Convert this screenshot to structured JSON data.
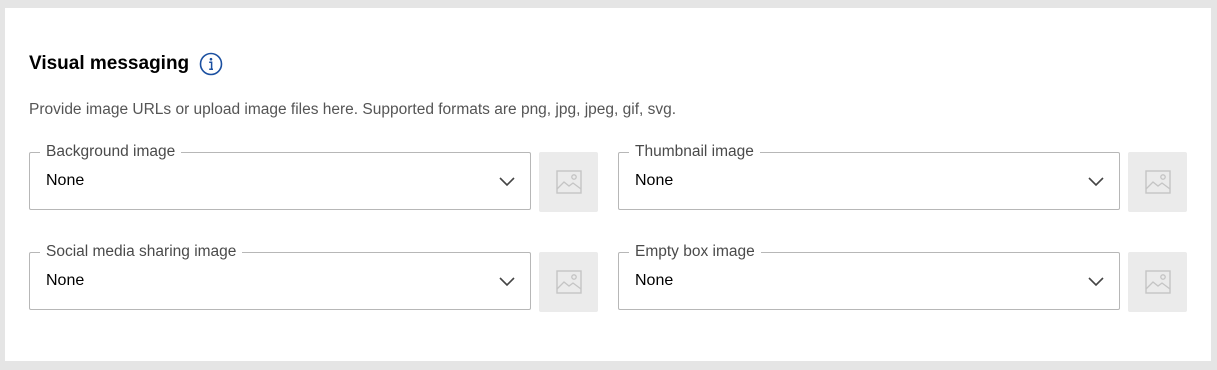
{
  "section": {
    "title": "Visual messaging",
    "description": "Provide image URLs or upload image files here. Supported formats are png, jpg, jpeg, gif, svg."
  },
  "icons": {
    "info": "info-circle-icon",
    "chevron": "chevron-down-icon",
    "image_placeholder": "image-placeholder-icon"
  },
  "colors": {
    "accent": "#1a4fa0",
    "border": "#b7b7b7",
    "placeholder_bg": "#ebebeb"
  },
  "fields": {
    "background_image": {
      "label": "Background image",
      "value": "None"
    },
    "thumbnail_image": {
      "label": "Thumbnail image",
      "value": "None"
    },
    "social_media_sharing_image": {
      "label": "Social media sharing image",
      "value": "None"
    },
    "empty_box_image": {
      "label": "Empty box image",
      "value": "None"
    }
  }
}
